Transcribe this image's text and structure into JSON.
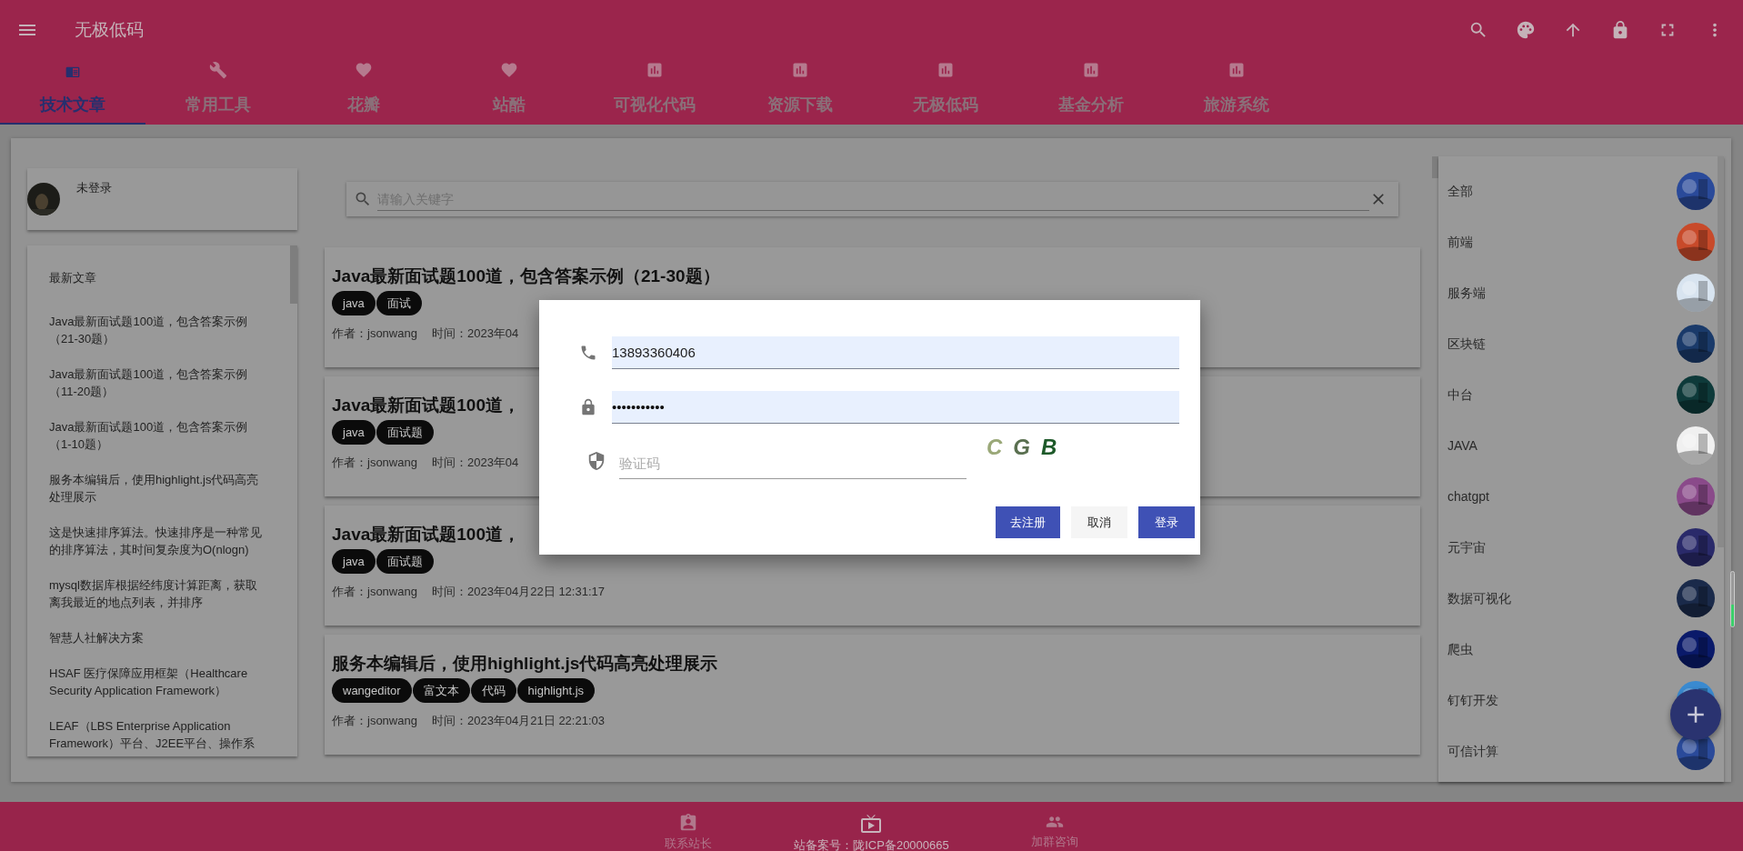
{
  "app_bar": {
    "title": "无极低码"
  },
  "tabs": [
    {
      "label": "技术文章",
      "kind": "article",
      "selected": true
    },
    {
      "label": "常用工具",
      "kind": "tool",
      "selected": false
    },
    {
      "label": "花瓣",
      "kind": "heart",
      "selected": false
    },
    {
      "label": "站酷",
      "kind": "heart",
      "selected": false
    },
    {
      "label": "可视化代码",
      "kind": "chart",
      "selected": false
    },
    {
      "label": "资源下载",
      "kind": "chart",
      "selected": false
    },
    {
      "label": "无极低码",
      "kind": "chart",
      "selected": false
    },
    {
      "label": "基金分析",
      "kind": "chart",
      "selected": false
    },
    {
      "label": "旅游系统",
      "kind": "chart",
      "selected": false
    }
  ],
  "user": {
    "name": "未登录"
  },
  "latest": {
    "title": "最新文章",
    "items": [
      "Java最新面试题100道，包含答案示例（21-30题）",
      "Java最新面试题100道，包含答案示例（11-20题）",
      "Java最新面试题100道，包含答案示例（1-10题）",
      "服务本编辑后，使用highlight.js代码高亮处理展示",
      "这是快速排序算法。快速排序是一种常见的排序算法，其时间复杂度为O(nlogn)",
      "mysql数据库根据经纬度计算距离，获取离我最近的地点列表，并排序",
      "智慧人社解决方案",
      "HSAF 医疗保障应用框架（Healthcare Security Application Framework）",
      "LEAF（LBS Enterprise Application Framework）平台、J2EE平台、操作系"
    ]
  },
  "search": {
    "placeholder": "请输入关键字"
  },
  "articles": [
    {
      "title": "Java最新面试题100道，包含答案示例（21-30题）",
      "tags": [
        "java",
        "面试"
      ],
      "author": "作者：jsonwang",
      "time": "时间：2023年04"
    },
    {
      "title": "Java最新面试题100道，",
      "tags": [
        "java",
        "面试题"
      ],
      "author": "作者：jsonwang",
      "time": "时间：2023年04"
    },
    {
      "title": "Java最新面试题100道，",
      "tags": [
        "java",
        "面试题"
      ],
      "author": "作者：jsonwang",
      "time": "时间：2023年04月22日 12:31:17"
    },
    {
      "title": "服务本编辑后，使用highlight.js代码高亮处理展示",
      "tags": [
        "wangeditor",
        "富文本",
        "代码",
        "highlight.js"
      ],
      "author": "作者：jsonwang",
      "time": "时间：2023年04月21日 22:21:03"
    }
  ],
  "categories": [
    {
      "name": "全部"
    },
    {
      "name": "前端"
    },
    {
      "name": "服务端"
    },
    {
      "name": "区块链"
    },
    {
      "name": "中台"
    },
    {
      "name": "JAVA"
    },
    {
      "name": "chatgpt"
    },
    {
      "name": "元宇宙"
    },
    {
      "name": "数据可视化"
    },
    {
      "name": "爬虫"
    },
    {
      "name": "钉钉开发"
    },
    {
      "name": "可信计算"
    }
  ],
  "login_dialog": {
    "phone": "13893360406",
    "password": "•••••••••••",
    "captcha_placeholder": "验证码",
    "captcha": [
      {
        "char": "C",
        "color": "#9aa878"
      },
      {
        "char": "G",
        "color": "#5a7050"
      },
      {
        "char": "B",
        "color": "#1e5a2a"
      }
    ],
    "buttons": [
      {
        "label": "去注册",
        "kind": "primary"
      },
      {
        "label": "取消",
        "kind": "plain"
      },
      {
        "label": "登录",
        "kind": "primary"
      }
    ]
  },
  "footer": [
    {
      "label": "联系站长",
      "kind": "contact"
    },
    {
      "label": "站备案号：陇ICP备20000665",
      "kind": "tv"
    },
    {
      "label": "加群咨询",
      "kind": "group"
    }
  ]
}
